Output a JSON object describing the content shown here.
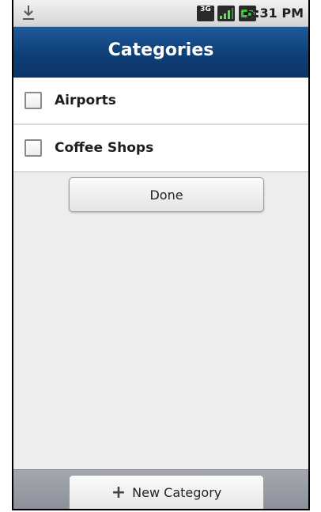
{
  "status_bar": {
    "time": "5:31 PM",
    "network_type": "3G",
    "icons": [
      "download-icon",
      "network-3g-icon",
      "signal-icon",
      "battery-icon"
    ]
  },
  "header": {
    "title": "Categories"
  },
  "categories": [
    {
      "label": "Airports",
      "checked": false
    },
    {
      "label": "Coffee Shops",
      "checked": false
    }
  ],
  "actions": {
    "done_label": "Done",
    "new_category_label": "New Category",
    "new_category_icon": "plus-icon"
  },
  "colors": {
    "title_bar": "#0f3f78",
    "background": "#efecef",
    "bottom_bar": "#8b909a",
    "battery_green": "#3cc23c"
  }
}
